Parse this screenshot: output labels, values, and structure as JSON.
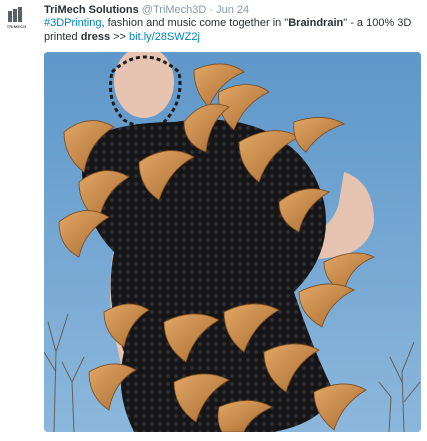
{
  "author": {
    "logo_text": "TRIMECH",
    "name": "TriMech Solutions",
    "handle": "@TriMech3D",
    "separator": "·",
    "date": "Jun 24"
  },
  "tweet": {
    "hashtag": "#3DPrinting",
    "text_part1": ", fashion and music come together in \"",
    "bold_word": "Braindrain",
    "text_part2": "\" - a 100% 3D printed ",
    "bold_word2": "dress",
    "text_part3": " >> ",
    "link": "bit.ly/28SWZ2j"
  },
  "media": {
    "kind": "photo",
    "subject": "3D printed dress",
    "colors": {
      "sky": "#6ba0cd",
      "lace": "#1c1c1e",
      "shell": "#c98a45",
      "skin": "#e7c3b1",
      "trees": "#5a4a3a"
    }
  }
}
